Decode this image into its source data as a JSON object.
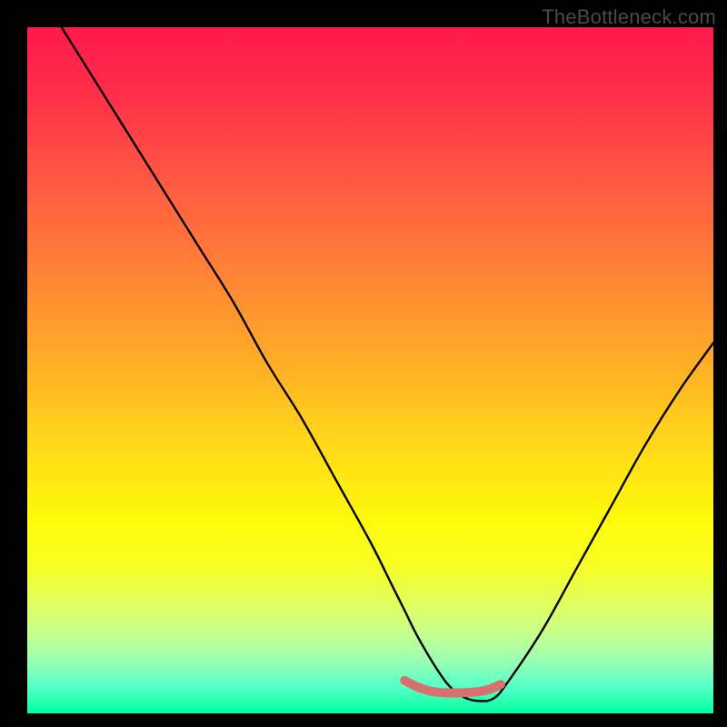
{
  "watermark": "TheBottleneck.com",
  "chart_data": {
    "type": "line",
    "title": "",
    "xlabel": "",
    "ylabel": "",
    "xlim": [
      0,
      100
    ],
    "ylim": [
      0,
      100
    ],
    "series": [
      {
        "name": "main-curve",
        "color": "#000000",
        "x": [
          5,
          10,
          15,
          20,
          25,
          30,
          35,
          40,
          45,
          50,
          53,
          55,
          57,
          60,
          62,
          64,
          66,
          68,
          70,
          75,
          80,
          85,
          90,
          95,
          100
        ],
        "values": [
          100,
          92,
          84,
          76,
          68,
          60,
          51,
          43,
          34,
          25,
          19,
          15,
          11,
          6,
          3.5,
          2.2,
          1.8,
          2.2,
          4.5,
          12,
          21,
          30,
          39,
          47,
          54
        ]
      },
      {
        "name": "highlight-segment",
        "color": "#d9706e",
        "x": [
          55,
          57,
          59,
          61,
          63,
          65,
          67,
          69
        ],
        "values": [
          4.8,
          3.8,
          3.2,
          3.0,
          3.0,
          3.1,
          3.4,
          4.2
        ]
      }
    ],
    "gradient_stops": [
      {
        "pos": 0,
        "color": "#ff1a4d"
      },
      {
        "pos": 50,
        "color": "#ffcf1c"
      },
      {
        "pos": 100,
        "color": "#00ffa0"
      }
    ]
  }
}
